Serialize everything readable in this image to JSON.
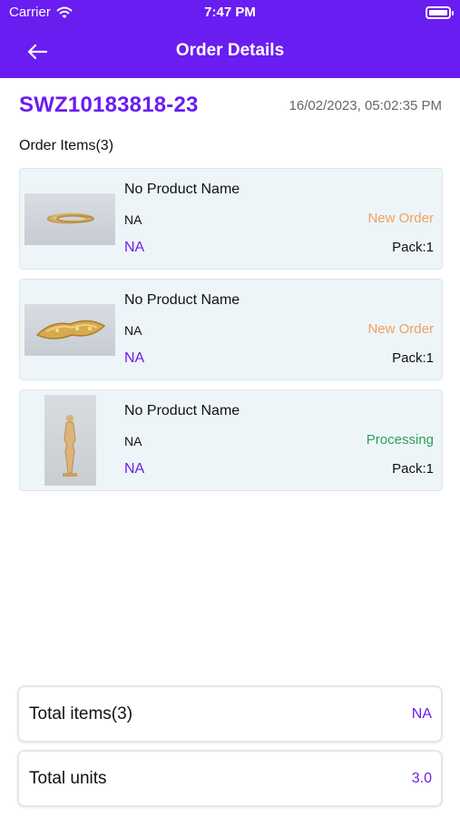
{
  "status_bar": {
    "carrier": "Carrier",
    "time": "7:47 PM",
    "icons": [
      "wifi-icon",
      "battery-icon"
    ]
  },
  "nav": {
    "title": "Order Details",
    "back_icon": "arrow-left-icon"
  },
  "order": {
    "id": "SWZ10183818-23",
    "date": "16/02/2023, 05:02:35 PM",
    "items_title": "Order Items(3)"
  },
  "items": [
    {
      "name": "No Product Name",
      "sub": "NA",
      "price": "NA",
      "status": "New Order",
      "status_color": "#f0a060",
      "pack": "Pack:1",
      "image": "gold-bangles-image"
    },
    {
      "name": "No Product Name",
      "sub": "NA",
      "price": "NA",
      "status": "New Order",
      "status_color": "#f0a060",
      "pack": "Pack:1",
      "image": "gold-bracelet-image"
    },
    {
      "name": "No Product Name",
      "sub": "NA",
      "price": "NA",
      "status": "Processing",
      "status_color": "#2e9e5a",
      "pack": "Pack:1",
      "image": "gold-statue-image"
    }
  ],
  "summary": {
    "total_items_label": "Total items(3)",
    "total_items_value": "NA",
    "total_units_label": "Total units",
    "total_units_value": "3.0"
  },
  "colors": {
    "accent": "#6a1df0",
    "card_background": "#eef5f8"
  }
}
